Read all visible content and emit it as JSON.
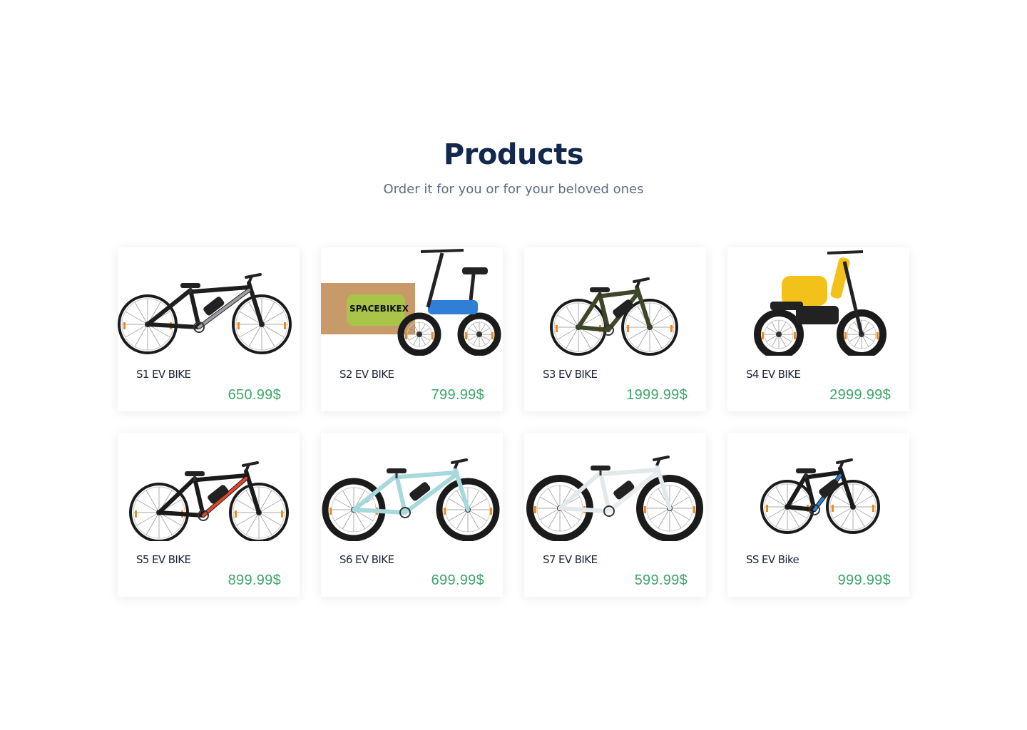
{
  "header": {
    "title": "Products",
    "subtitle": "Order it for you or for your beloved ones"
  },
  "theme": {
    "title_color": "#13284d",
    "subtitle_color": "#5b6b82",
    "price_color": "#3fa46a"
  },
  "products": [
    {
      "name": "S1 EV BIKE",
      "price": "650.99$",
      "image_icon": "ev-mountain-bike-silver",
      "accent": "#9aa0a6"
    },
    {
      "name": "S2 EV BIKE",
      "price": "799.99$",
      "image_icon": "ev-scooter-with-box-blue",
      "accent": "#2f7fd6",
      "box_label": "SPACEBIKEX"
    },
    {
      "name": "S3 EV BIKE",
      "price": "1999.99$",
      "image_icon": "ev-folding-bike-green",
      "accent": "#3f4a2a"
    },
    {
      "name": "S4 EV BIKE",
      "price": "2999.99$",
      "image_icon": "ev-moped-yellow",
      "accent": "#f2c21b"
    },
    {
      "name": "S5 EV BIKE",
      "price": "899.99$",
      "image_icon": "ev-mountain-bike-red",
      "accent": "#e2462c"
    },
    {
      "name": "S6 EV BIKE",
      "price": "699.99$",
      "image_icon": "ev-cruiser-bike-lightblue",
      "accent": "#a6d8dc"
    },
    {
      "name": "S7 EV BIKE",
      "price": "599.99$",
      "image_icon": "ev-fat-tire-bike-white",
      "accent": "#e9eef0"
    },
    {
      "name": "SS EV Bike",
      "price": "999.99$",
      "image_icon": "ev-mountain-bike-black",
      "accent": "#2a7fd0"
    }
  ]
}
